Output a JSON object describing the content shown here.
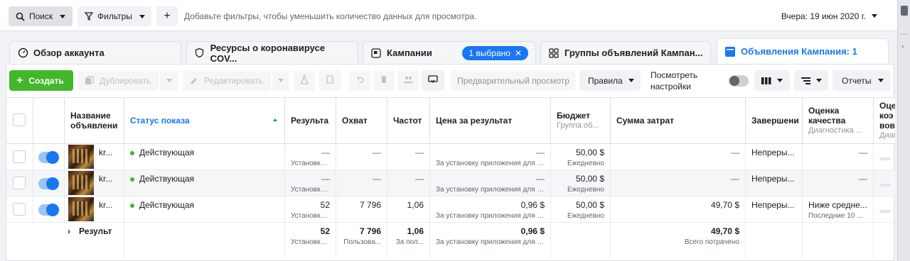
{
  "topbar": {
    "search_label": "Поиск",
    "filters_label": "Фильтры",
    "add_filter_label": "+",
    "filter_hint": "Добавьте фильтры, чтобы уменьшить количество данных для просмотра.",
    "date_range": "Вчера: 19 июн 2020 г."
  },
  "tabs": [
    {
      "label": "Обзор аккаунта",
      "icon": "gauge-icon"
    },
    {
      "label": "Ресурсы о коронавирусе COV...",
      "icon": "shield-heart-icon"
    },
    {
      "label": "Кампании",
      "icon": "flag-icon",
      "badge": "1 выбрано"
    },
    {
      "label": "Группы объявлений Кампан...",
      "icon": "grid-icon"
    },
    {
      "label": "Объявления Кампания: 1",
      "icon": "ad-icon"
    }
  ],
  "toolbar": {
    "create_label": "Создать",
    "duplicate_label": "Дублировать",
    "edit_label": "Редактировать",
    "preview_label": "Предварительный просмотр",
    "rules_label": "Правила",
    "view_settings_line1": "Посмотреть",
    "view_settings_line2": "настройки",
    "reports_label": "Отчеты"
  },
  "table": {
    "headers": {
      "name": [
        "Название",
        "объявлени"
      ],
      "status": "Статус показа",
      "results": "Результа",
      "reach": "Охват",
      "frequency": "Частот",
      "cost_per_result": "Цена за результат",
      "budget": "Бюджет",
      "budget_sub": "Группа об...",
      "amount_spent": "Сумма затрат",
      "ends": "Завершени",
      "quality": [
        "Оценка",
        "качества"
      ],
      "quality_sub": "Диагностика ...",
      "next": [
        "Оце",
        "коэ",
        "вов"
      ],
      "next_sub": "Диаг"
    },
    "rows": [
      {
        "name": "kr...",
        "status": "Действующая",
        "results": "—",
        "results_sub": "Установка...",
        "reach": "—",
        "frequency": "—",
        "cpr": "—",
        "cpr_sub": "За установку приложения для м...",
        "budget": "50,00 $",
        "budget_sub": "Ежедневно",
        "spent": "—",
        "ends": "Непреры...",
        "quality": "—",
        "quality_sub": ""
      },
      {
        "name": "kr...",
        "status": "Действующая",
        "results": "—",
        "results_sub": "Установка...",
        "reach": "—",
        "frequency": "—",
        "cpr": "—",
        "cpr_sub": "За установку приложения для м...",
        "budget": "50,00 $",
        "budget_sub": "Ежедневно",
        "spent": "—",
        "ends": "Непреры...",
        "quality": "—",
        "quality_sub": ""
      },
      {
        "name": "kr...",
        "status": "Действующая",
        "results": "52",
        "results_sub": "Установки...",
        "reach": "7 796",
        "frequency": "1,06",
        "cpr": "0,96 $",
        "cpr_sub": "За установку приложения для м...",
        "budget": "50,00 $",
        "budget_sub": "Ежедневно",
        "spent": "49,70 $",
        "ends": "Непреры...",
        "quality": "Ниже средне...",
        "quality_sub": "Последние 10 ..."
      }
    ],
    "total": {
      "label": "Результ",
      "results": "52",
      "results_sub": "Установки...",
      "reach": "7 796",
      "reach_sub": "Пользова...",
      "frequency": "1,06",
      "frequency_sub": "За пол...",
      "cpr": "0,96 $",
      "cpr_sub": "За установку приложения для м...",
      "spent": "49,70 $",
      "spent_sub": "Всего потрачено"
    }
  },
  "colors": {
    "accent": "#1877f2",
    "create": "#42b72a",
    "active_dot": "#42b72a"
  }
}
